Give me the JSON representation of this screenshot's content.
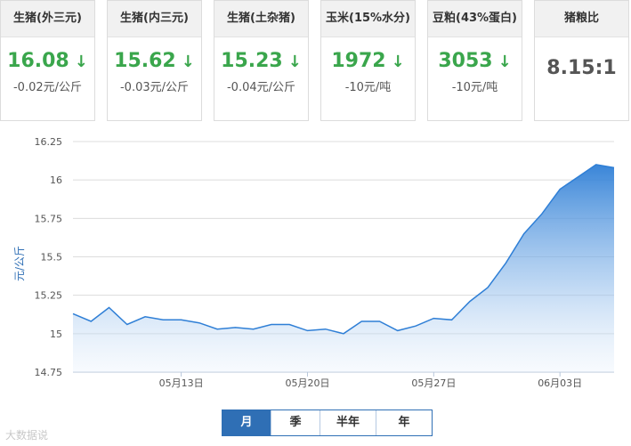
{
  "cards": [
    {
      "title": "生猪(外三元)",
      "value": "16.08",
      "change": "-0.02元/公斤",
      "direction": "down"
    },
    {
      "title": "生猪(内三元)",
      "value": "15.62",
      "change": "-0.03元/公斤",
      "direction": "down"
    },
    {
      "title": "生猪(土杂猪)",
      "value": "15.23",
      "change": "-0.04元/公斤",
      "direction": "down"
    },
    {
      "title": "玉米(15%水分)",
      "value": "1972",
      "change": "-10元/吨",
      "direction": "down"
    },
    {
      "title": "豆粕(43%蛋白)",
      "value": "3053",
      "change": "-10元/吨",
      "direction": "down"
    }
  ],
  "ratio_card": {
    "title": "猪粮比",
    "value": "8.15:1"
  },
  "arrow_glyph": "↓",
  "colors": {
    "down": "#3aa64c",
    "accent": "#2f6fb5",
    "line": "#2f7fd6"
  },
  "period_tabs": [
    {
      "label": "月",
      "active": true
    },
    {
      "label": "季",
      "active": false
    },
    {
      "label": "半年",
      "active": false
    },
    {
      "label": "年",
      "active": false
    }
  ],
  "watermark": "大数据说",
  "chart_data": {
    "type": "area",
    "ylabel": "元/公斤",
    "ylim": [
      14.75,
      16.25
    ],
    "yticks": [
      "16.25",
      "16",
      "15.75",
      "15.5",
      "15.25",
      "15",
      "14.75"
    ],
    "xtick_labels": [
      {
        "label": "05月13日",
        "index": 6
      },
      {
        "label": "05月20日",
        "index": 13
      },
      {
        "label": "05月27日",
        "index": 20
      },
      {
        "label": "06月03日",
        "index": 27
      }
    ],
    "values": [
      15.13,
      15.08,
      15.17,
      15.06,
      15.11,
      15.09,
      15.09,
      15.07,
      15.03,
      15.04,
      15.03,
      15.06,
      15.06,
      15.02,
      15.03,
      15.0,
      15.08,
      15.08,
      15.02,
      15.05,
      15.1,
      15.09,
      15.21,
      15.3,
      15.46,
      15.65,
      15.78,
      15.94,
      16.02,
      16.1,
      16.08
    ],
    "grid": true,
    "legend": "none"
  }
}
